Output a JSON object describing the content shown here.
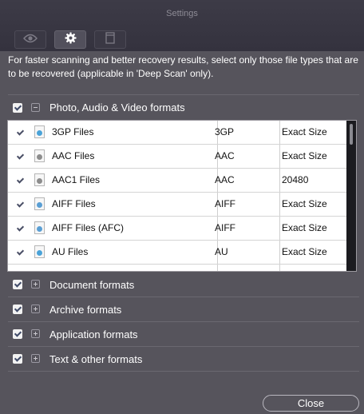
{
  "window": {
    "title": "Settings"
  },
  "toolbar": {
    "tabs": [
      {
        "icon": "eye-icon",
        "active": false
      },
      {
        "icon": "gear-icon",
        "active": true
      },
      {
        "icon": "document-icon",
        "active": false
      }
    ]
  },
  "description": "For faster scanning and better recovery results, select only those file types that are to be recovered (applicable in 'Deep Scan' only).",
  "groups": [
    {
      "label": "Photo, Audio & Video formats",
      "checked": true,
      "expanded": true
    },
    {
      "label": "Document formats",
      "checked": true,
      "expanded": false
    },
    {
      "label": "Archive formats",
      "checked": true,
      "expanded": false
    },
    {
      "label": "Application formats",
      "checked": true,
      "expanded": false
    },
    {
      "label": "Text & other formats",
      "checked": true,
      "expanded": false
    }
  ],
  "table": {
    "rows": [
      {
        "name": "3GP Files",
        "ext": "3GP",
        "size": "Exact Size",
        "icon": "video-file-icon",
        "checked": true
      },
      {
        "name": "AAC Files",
        "ext": "AAC",
        "size": "Exact Size",
        "icon": "audio-file-icon",
        "checked": true
      },
      {
        "name": "AAC1 Files",
        "ext": "AAC",
        "size": "20480",
        "icon": "audio-file-icon",
        "checked": true
      },
      {
        "name": "AIFF Files",
        "ext": "AIFF",
        "size": "Exact Size",
        "icon": "music-file-icon",
        "checked": true
      },
      {
        "name": "AIFF Files (AFC)",
        "ext": "AIFF",
        "size": "Exact Size",
        "icon": "music-file-icon",
        "checked": true
      },
      {
        "name": "AU Files",
        "ext": "AU",
        "size": "Exact Size",
        "icon": "audio-file-icon",
        "checked": true
      }
    ]
  },
  "footer": {
    "close_label": "Close"
  },
  "colors": {
    "background": "#56545c",
    "titlebar": "#3a3844",
    "checkbox_tick": "#3f4a68"
  }
}
